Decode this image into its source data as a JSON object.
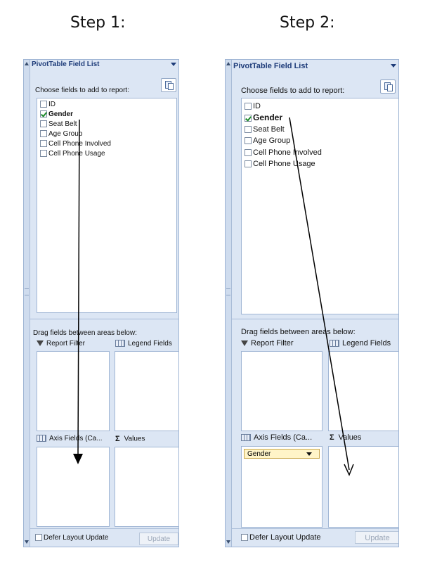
{
  "steps": [
    {
      "title": "Step 1:",
      "panel_title": "PivotTable Field List",
      "choose_label": "Choose fields to add to report:",
      "fields": [
        {
          "label": "ID",
          "checked": false
        },
        {
          "label": "Gender",
          "checked": true
        },
        {
          "label": "Seat Belt",
          "checked": false
        },
        {
          "label": "Age Group",
          "checked": false
        },
        {
          "label": "Cell Phone Involved",
          "checked": false
        },
        {
          "label": "Cell Phone Usage",
          "checked": false
        }
      ],
      "drag_label": "Drag fields between areas below:",
      "areas": {
        "report_filter": "Report Filter",
        "legend_fields": "Legend Fields",
        "axis_fields": "Axis Fields (Ca...",
        "values": "Values"
      },
      "axis_items": [],
      "defer_label": "Defer Layout Update",
      "update_label": "Update"
    },
    {
      "title": "Step 2:",
      "panel_title": "PivotTable Field List",
      "choose_label": "Choose fields to add to report:",
      "fields": [
        {
          "label": "ID",
          "checked": false
        },
        {
          "label": "Gender",
          "checked": true
        },
        {
          "label": "Seat Belt",
          "checked": false
        },
        {
          "label": "Age Group",
          "checked": false
        },
        {
          "label": "Cell Phone Involved",
          "checked": false
        },
        {
          "label": "Cell Phone Usage",
          "checked": false
        }
      ],
      "drag_label": "Drag fields between areas below:",
      "areas": {
        "report_filter": "Report Filter",
        "legend_fields": "Legend Fields",
        "axis_fields": "Axis Fields (Ca...",
        "values": "Values"
      },
      "axis_items": [
        "Gender"
      ],
      "defer_label": "Defer Layout Update",
      "update_label": "Update"
    }
  ]
}
